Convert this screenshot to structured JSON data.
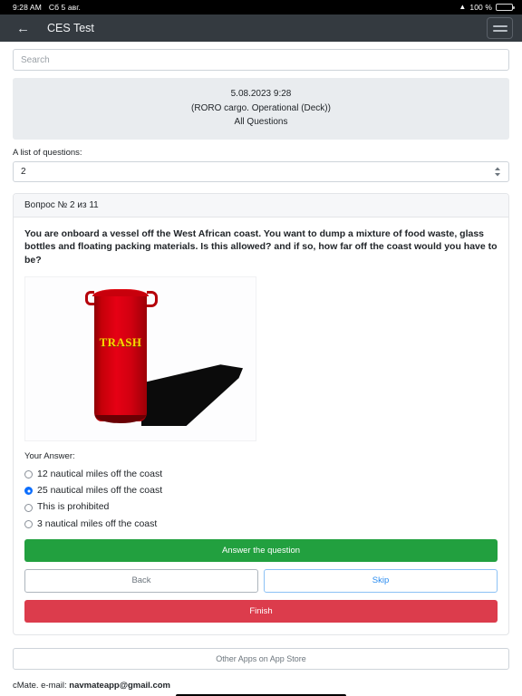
{
  "status_bar": {
    "time": "9:28 AM",
    "date": "Сб 5 авг.",
    "wifi_icon": "wifi-icon",
    "battery_percent": "100 %",
    "battery_icon": "battery-icon"
  },
  "header": {
    "back_icon": "back-arrow-icon",
    "title": "CES Test",
    "menu_icon": "hamburger-menu-icon"
  },
  "search": {
    "placeholder": "Search",
    "value": ""
  },
  "info_panel": {
    "datetime": "5.08.2023 9:28",
    "course": "(RORO cargo. Operational (Deck))",
    "scope": "All Questions"
  },
  "question_list": {
    "label": "A list of questions:",
    "selected": "2",
    "stepper_icon": "stepper-chevron-icon"
  },
  "card": {
    "header": "Вопрос № 2 из 11",
    "question": "You are onboard a vessel off the West African coast. You want to dump a mixture of food waste, glass bottles and floating packing materials. Is this allowed? and if so, how far off the coast would you have to be?",
    "image": {
      "name": "trash-can-illustration",
      "label": "TRASH"
    },
    "answer_label": "Your Answer:",
    "options": [
      {
        "text": "12 nautical miles off the coast",
        "selected": false
      },
      {
        "text": "25 nautical miles off the coast",
        "selected": true
      },
      {
        "text": "This is prohibited",
        "selected": false
      },
      {
        "text": "3 nautical miles off the coast",
        "selected": false
      }
    ],
    "buttons": {
      "answer": "Answer the question",
      "back": "Back",
      "skip": "Skip",
      "finish": "Finish"
    }
  },
  "footer": {
    "store_button": "Other Apps on App Store",
    "note_prefix": "cMate. e-mail: ",
    "note_email": "navmateapp@gmail.com"
  },
  "colors": {
    "header_bg": "#343a40",
    "answer_green": "#22a03f",
    "finish_red": "#dc3c4c",
    "skip_blue": "#2a8cf0",
    "radio_blue": "#0d6efd",
    "info_panel_bg": "#e9ecef"
  }
}
